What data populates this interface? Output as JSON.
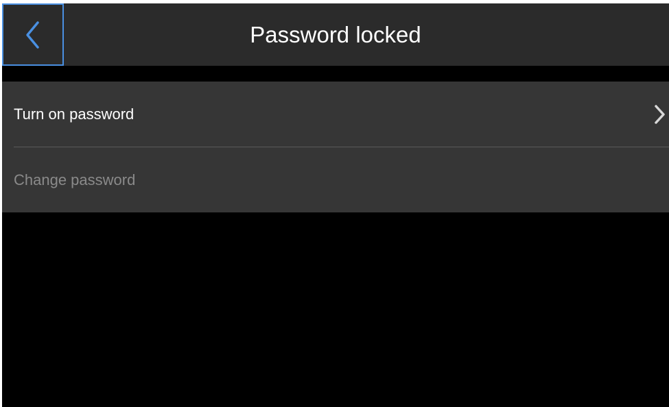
{
  "header": {
    "title": "Password locked",
    "back_icon": "chevron-left-icon"
  },
  "menu": {
    "items": [
      {
        "label": "Turn on password",
        "enabled": true,
        "icon": "chevron-right-icon"
      },
      {
        "label": "Change password",
        "enabled": false
      }
    ]
  },
  "colors": {
    "header_bg": "#2b2b2b",
    "list_bg": "#363636",
    "background": "#000000",
    "focus_outline": "#4a90e2",
    "text_primary": "#ffffff",
    "text_disabled": "#8a8a8a"
  }
}
